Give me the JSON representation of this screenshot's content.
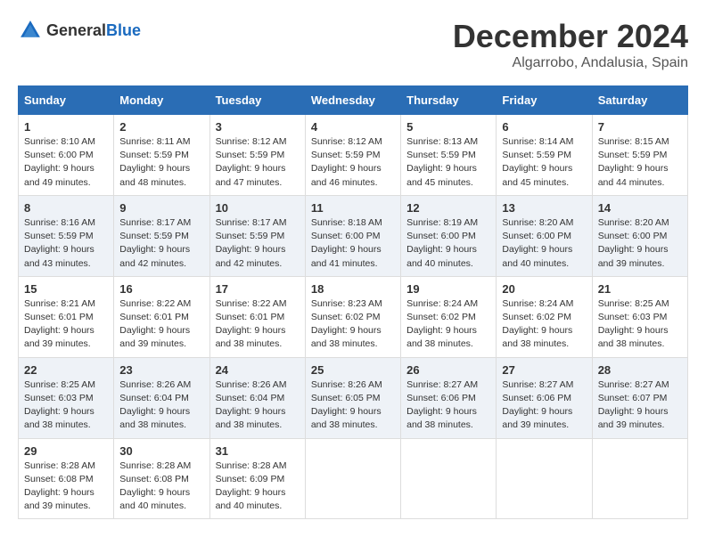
{
  "logo": {
    "general": "General",
    "blue": "Blue"
  },
  "title": {
    "month": "December 2024",
    "location": "Algarrobo, Andalusia, Spain"
  },
  "headers": [
    "Sunday",
    "Monday",
    "Tuesday",
    "Wednesday",
    "Thursday",
    "Friday",
    "Saturday"
  ],
  "weeks": [
    [
      {
        "day": "1",
        "sunrise": "8:10 AM",
        "sunset": "6:00 PM",
        "daylight": "9 hours and 49 minutes."
      },
      {
        "day": "2",
        "sunrise": "8:11 AM",
        "sunset": "5:59 PM",
        "daylight": "9 hours and 48 minutes."
      },
      {
        "day": "3",
        "sunrise": "8:12 AM",
        "sunset": "5:59 PM",
        "daylight": "9 hours and 47 minutes."
      },
      {
        "day": "4",
        "sunrise": "8:12 AM",
        "sunset": "5:59 PM",
        "daylight": "9 hours and 46 minutes."
      },
      {
        "day": "5",
        "sunrise": "8:13 AM",
        "sunset": "5:59 PM",
        "daylight": "9 hours and 45 minutes."
      },
      {
        "day": "6",
        "sunrise": "8:14 AM",
        "sunset": "5:59 PM",
        "daylight": "9 hours and 45 minutes."
      },
      {
        "day": "7",
        "sunrise": "8:15 AM",
        "sunset": "5:59 PM",
        "daylight": "9 hours and 44 minutes."
      }
    ],
    [
      {
        "day": "8",
        "sunrise": "8:16 AM",
        "sunset": "5:59 PM",
        "daylight": "9 hours and 43 minutes."
      },
      {
        "day": "9",
        "sunrise": "8:17 AM",
        "sunset": "5:59 PM",
        "daylight": "9 hours and 42 minutes."
      },
      {
        "day": "10",
        "sunrise": "8:17 AM",
        "sunset": "5:59 PM",
        "daylight": "9 hours and 42 minutes."
      },
      {
        "day": "11",
        "sunrise": "8:18 AM",
        "sunset": "6:00 PM",
        "daylight": "9 hours and 41 minutes."
      },
      {
        "day": "12",
        "sunrise": "8:19 AM",
        "sunset": "6:00 PM",
        "daylight": "9 hours and 40 minutes."
      },
      {
        "day": "13",
        "sunrise": "8:20 AM",
        "sunset": "6:00 PM",
        "daylight": "9 hours and 40 minutes."
      },
      {
        "day": "14",
        "sunrise": "8:20 AM",
        "sunset": "6:00 PM",
        "daylight": "9 hours and 39 minutes."
      }
    ],
    [
      {
        "day": "15",
        "sunrise": "8:21 AM",
        "sunset": "6:01 PM",
        "daylight": "9 hours and 39 minutes."
      },
      {
        "day": "16",
        "sunrise": "8:22 AM",
        "sunset": "6:01 PM",
        "daylight": "9 hours and 39 minutes."
      },
      {
        "day": "17",
        "sunrise": "8:22 AM",
        "sunset": "6:01 PM",
        "daylight": "9 hours and 38 minutes."
      },
      {
        "day": "18",
        "sunrise": "8:23 AM",
        "sunset": "6:02 PM",
        "daylight": "9 hours and 38 minutes."
      },
      {
        "day": "19",
        "sunrise": "8:24 AM",
        "sunset": "6:02 PM",
        "daylight": "9 hours and 38 minutes."
      },
      {
        "day": "20",
        "sunrise": "8:24 AM",
        "sunset": "6:02 PM",
        "daylight": "9 hours and 38 minutes."
      },
      {
        "day": "21",
        "sunrise": "8:25 AM",
        "sunset": "6:03 PM",
        "daylight": "9 hours and 38 minutes."
      }
    ],
    [
      {
        "day": "22",
        "sunrise": "8:25 AM",
        "sunset": "6:03 PM",
        "daylight": "9 hours and 38 minutes."
      },
      {
        "day": "23",
        "sunrise": "8:26 AM",
        "sunset": "6:04 PM",
        "daylight": "9 hours and 38 minutes."
      },
      {
        "day": "24",
        "sunrise": "8:26 AM",
        "sunset": "6:04 PM",
        "daylight": "9 hours and 38 minutes."
      },
      {
        "day": "25",
        "sunrise": "8:26 AM",
        "sunset": "6:05 PM",
        "daylight": "9 hours and 38 minutes."
      },
      {
        "day": "26",
        "sunrise": "8:27 AM",
        "sunset": "6:06 PM",
        "daylight": "9 hours and 38 minutes."
      },
      {
        "day": "27",
        "sunrise": "8:27 AM",
        "sunset": "6:06 PM",
        "daylight": "9 hours and 39 minutes."
      },
      {
        "day": "28",
        "sunrise": "8:27 AM",
        "sunset": "6:07 PM",
        "daylight": "9 hours and 39 minutes."
      }
    ],
    [
      {
        "day": "29",
        "sunrise": "8:28 AM",
        "sunset": "6:08 PM",
        "daylight": "9 hours and 39 minutes."
      },
      {
        "day": "30",
        "sunrise": "8:28 AM",
        "sunset": "6:08 PM",
        "daylight": "9 hours and 40 minutes."
      },
      {
        "day": "31",
        "sunrise": "8:28 AM",
        "sunset": "6:09 PM",
        "daylight": "9 hours and 40 minutes."
      },
      null,
      null,
      null,
      null
    ]
  ],
  "labels": {
    "sunrise": "Sunrise:",
    "sunset": "Sunset:",
    "daylight": "Daylight:"
  }
}
